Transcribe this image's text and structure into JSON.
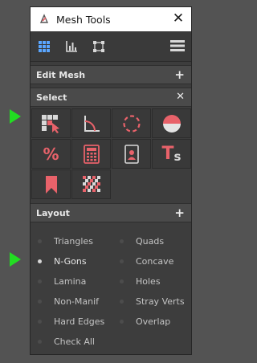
{
  "window": {
    "title": "Mesh Tools",
    "close_glyph": "✕"
  },
  "toolbar": {
    "icons": [
      "grid-icon",
      "stats-icon",
      "bounding-box-icon"
    ],
    "menu_icon": "hamburger-menu-icon"
  },
  "sections": {
    "edit_mesh": {
      "label": "Edit Mesh",
      "action": "+"
    },
    "select": {
      "label": "Select",
      "action": "✕"
    },
    "layout": {
      "label": "Layout",
      "action": "+"
    }
  },
  "select_tools": [
    {
      "name": "select-grid-cursor-icon"
    },
    {
      "name": "angle-icon"
    },
    {
      "name": "dashed-circle-icon"
    },
    {
      "name": "half-circle-icon"
    },
    {
      "name": "percent-icon",
      "glyph": "%"
    },
    {
      "name": "calculator-icon"
    },
    {
      "name": "id-badge-icon"
    },
    {
      "name": "text-size-icon",
      "glyph_big": "T",
      "glyph_small": "s"
    },
    {
      "name": "bookmark-icon"
    },
    {
      "name": "checker-diamond-icon"
    }
  ],
  "layout_options": [
    {
      "label": "Triangles",
      "active": false
    },
    {
      "label": "Quads",
      "active": false
    },
    {
      "label": "N-Gons",
      "active": true
    },
    {
      "label": "Concave",
      "active": false
    },
    {
      "label": "Lamina",
      "active": false
    },
    {
      "label": "Holes",
      "active": false
    },
    {
      "label": "Non-Manif",
      "active": false
    },
    {
      "label": "Stray Verts",
      "active": false
    },
    {
      "label": "Hard Edges",
      "active": false
    },
    {
      "label": "Overlap",
      "active": false
    },
    {
      "label": "Check All",
      "active": false
    }
  ],
  "colors": {
    "accent": "#e8626a",
    "marker": "#22dd22",
    "toolbar_icon": "#5aa6ff"
  }
}
